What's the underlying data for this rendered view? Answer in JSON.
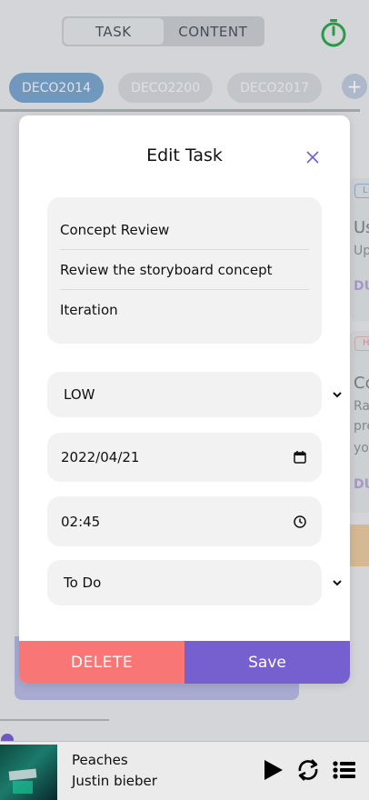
{
  "tabs": {
    "task": "TASK",
    "content": "CONTENT"
  },
  "courses": [
    "DECO2014",
    "DECO2200",
    "DECO2017"
  ],
  "add_course_symbol": "+",
  "background_cards": [
    {
      "tag": "L",
      "title": "Us",
      "lines": [
        "Up"
      ],
      "due": "DU"
    },
    {
      "tag": "H",
      "title": "Co",
      "lines": [
        "Ra",
        "pre",
        "yo"
      ],
      "due": "DU"
    }
  ],
  "modal": {
    "title": "Edit Task",
    "task_name": "Concept Review",
    "description": "Review the storyboard concept",
    "stage": "Iteration",
    "priority": "LOW",
    "due_date": "2022/04/21",
    "due_time": "02:45",
    "status": "To Do",
    "delete_label": "DELETE",
    "save_label": "Save"
  },
  "player": {
    "title": "Peaches",
    "artist": "Justin bieber"
  },
  "colors": {
    "accent_purple": "#765fcf",
    "delete_red": "#f97676",
    "timer_green": "#2fa84f",
    "course_active": "#7aa4cc"
  },
  "icons": [
    "timer-icon",
    "add-icon",
    "close-icon",
    "chevron-down-icon",
    "calendar-icon",
    "clock-icon",
    "play-icon",
    "repeat-icon",
    "playlist-icon"
  ]
}
